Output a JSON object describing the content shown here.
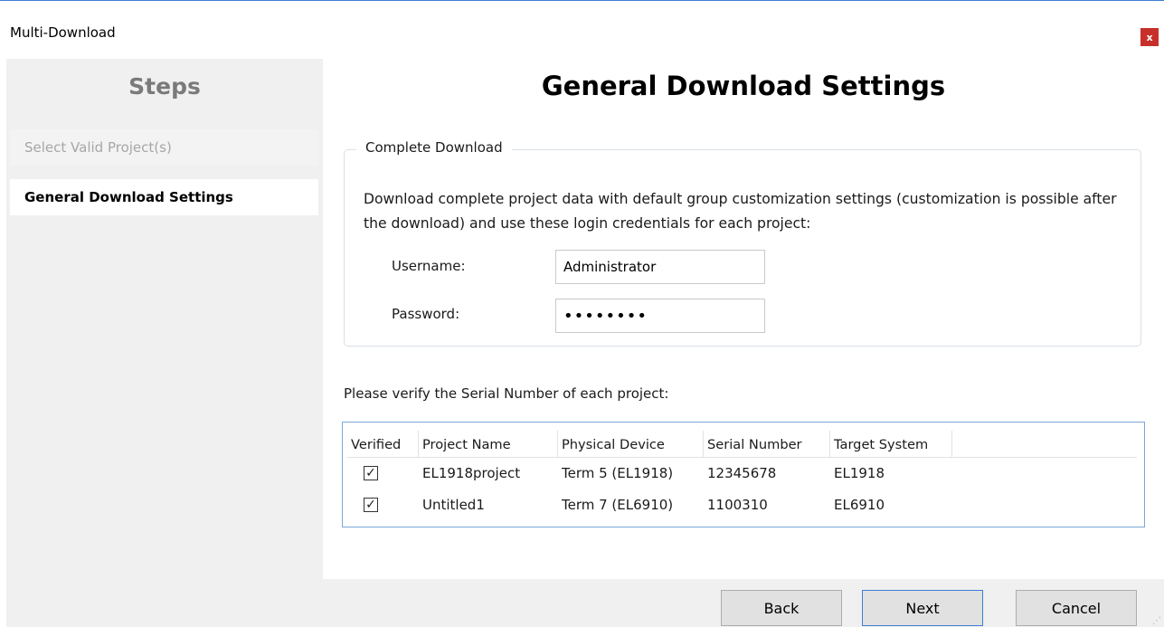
{
  "window": {
    "title": "Multi-Download",
    "close_label": "x"
  },
  "sidebar": {
    "title": "Steps",
    "items": [
      {
        "label": "Select Valid Project(s)"
      },
      {
        "label": "General Download Settings"
      }
    ]
  },
  "main": {
    "title": "General Download Settings",
    "group": {
      "legend": "Complete Download",
      "description": "Download complete project data with default group customization settings (customization is possible after the download) and use these login credentials for each project:",
      "username_label": "Username:",
      "username_value": "Administrator",
      "password_label": "Password:",
      "password_value": "••••••••"
    },
    "verify_text": "Please verify the Serial Number of each project:",
    "table": {
      "columns": [
        "Verified",
        "Project Name",
        "Physical Device",
        "Serial Number",
        "Target System"
      ],
      "rows": [
        {
          "verified": "✓",
          "project_name": "EL1918project",
          "physical_device": "Term 5 (EL1918)",
          "serial_number": "12345678",
          "target_system": "EL1918"
        },
        {
          "verified": "✓",
          "project_name": "Untitled1",
          "physical_device": "Term 7 (EL6910)",
          "serial_number": "1100310",
          "target_system": "EL6910"
        }
      ]
    }
  },
  "buttons": {
    "back": "Back",
    "next": "Next",
    "cancel": "Cancel"
  },
  "colors": {
    "accent": "#3c7fd6",
    "close": "#c7302a",
    "sidebar_bg": "#f0f0f0"
  }
}
